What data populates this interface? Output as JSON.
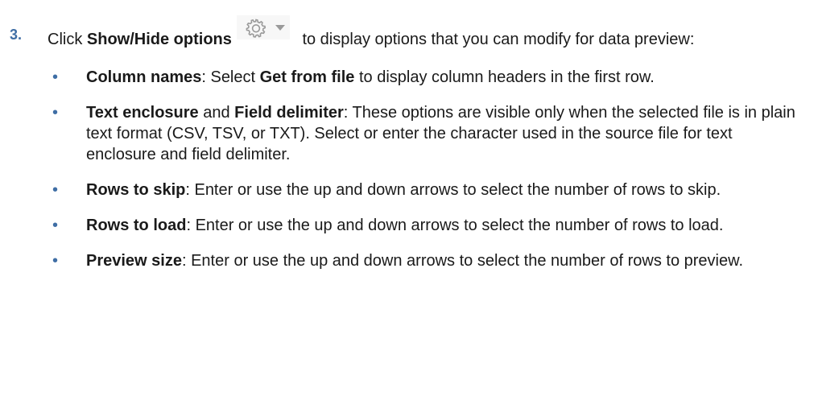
{
  "step": {
    "number": "3.",
    "intro_prefix": "Click ",
    "intro_bold": "Show/Hide options",
    "intro_suffix": " to display options that you can modify for data preview:",
    "icons": [
      "gear-icon",
      "chevron-down-icon"
    ]
  },
  "options": [
    {
      "bullet": "•",
      "term": "Column names",
      "text_a": ": Select ",
      "bold2": "Get from file",
      "text_b": " to display column headers in the first row."
    },
    {
      "bullet": "•",
      "term": "Text enclosure",
      "text_a": " and ",
      "bold2": "Field delimiter",
      "text_b": ": These options are visible only when the selected file is in plain text format (CSV, TSV, or TXT). Select or enter the character used in the source file for text enclosure and field delimiter."
    },
    {
      "bullet": "•",
      "term": "Rows to skip",
      "text_b": ": Enter or use the up and down arrows to select the number of rows to skip."
    },
    {
      "bullet": "•",
      "term": "Rows to load",
      "text_b": ": Enter or use the up and down arrows to select the number of rows to load."
    },
    {
      "bullet": "•",
      "term": "Preview size",
      "text_b": ": Enter or use the up and down arrows to select the number of rows to preview."
    }
  ],
  "colors": {
    "accent": "#3f6ea5",
    "text": "#1a1a1a",
    "icon": "#9a9a9a"
  }
}
